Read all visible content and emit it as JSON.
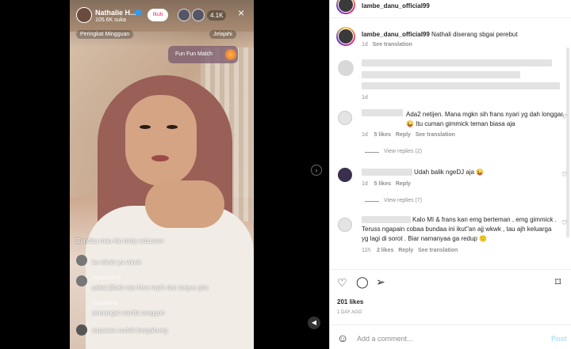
{
  "live": {
    "host_name": "Nathalie H...",
    "host_likes": "105.6K suka",
    "follow_label": "Ikuti",
    "viewer_count": "4.1K",
    "close_icon": "×",
    "weekly_rank": "Peringkat Mingguan",
    "explore": "Jelajahi",
    "fun_match": "Fun Fun Match",
    "comments": [
      {
        "user": "",
        "msg": "Bundaa mau liat baby adzamm"
      },
      {
        "user": "",
        "msg": "ka nikah yu wkwk"
      },
      {
        "user": "imaArmEno",
        "msg": "pakai jilbab nya bisa rapih dan bagus gitu"
      },
      {
        "user": "listianllaila",
        "msg": "semangat wanita tangguh"
      },
      {
        "user": "",
        "msg": "sapaaaa  sudah bergabung"
      }
    ]
  },
  "post": {
    "author": "lambe_danu_official99",
    "caption": "Nathali diserang sbgai perebut",
    "caption_time": "1d",
    "see_translation": "See translation"
  },
  "comments": [
    {
      "text": "",
      "meta_time": "1d",
      "meta_likes": "",
      "reply": ""
    },
    {
      "text": "Ada2 netijen. Mana mgkn sih frans nyari yg dah longgar. 😜 Itu cuman gimmick teman biasa aja",
      "meta_time": "1d",
      "meta_likes": "5 likes",
      "reply": "Reply",
      "translate": "See translation",
      "view_replies": "View replies (2)"
    },
    {
      "text": "Udah balik ngeDJ aja 😜",
      "meta_time": "1d",
      "meta_likes": "5 likes",
      "reply": "Reply",
      "view_replies": "View replies (7)"
    },
    {
      "text": "Kalo MI & frans kan emg berteman , emg gimmick . Teruss ngapain cobaa bundaa ini ikut\"an ajj wkwk , tau ajh keluarga yg lagi di sorot . Biar namanyaa ga redup 🙂",
      "meta_time": "11h",
      "meta_likes": "2 likes",
      "reply": "Reply",
      "translate": "See translation"
    }
  ],
  "actions": {
    "likes": "201 likes",
    "date": "1 DAY AGO",
    "add_comment_placeholder": "Add a comment...",
    "post_label": "Post"
  }
}
